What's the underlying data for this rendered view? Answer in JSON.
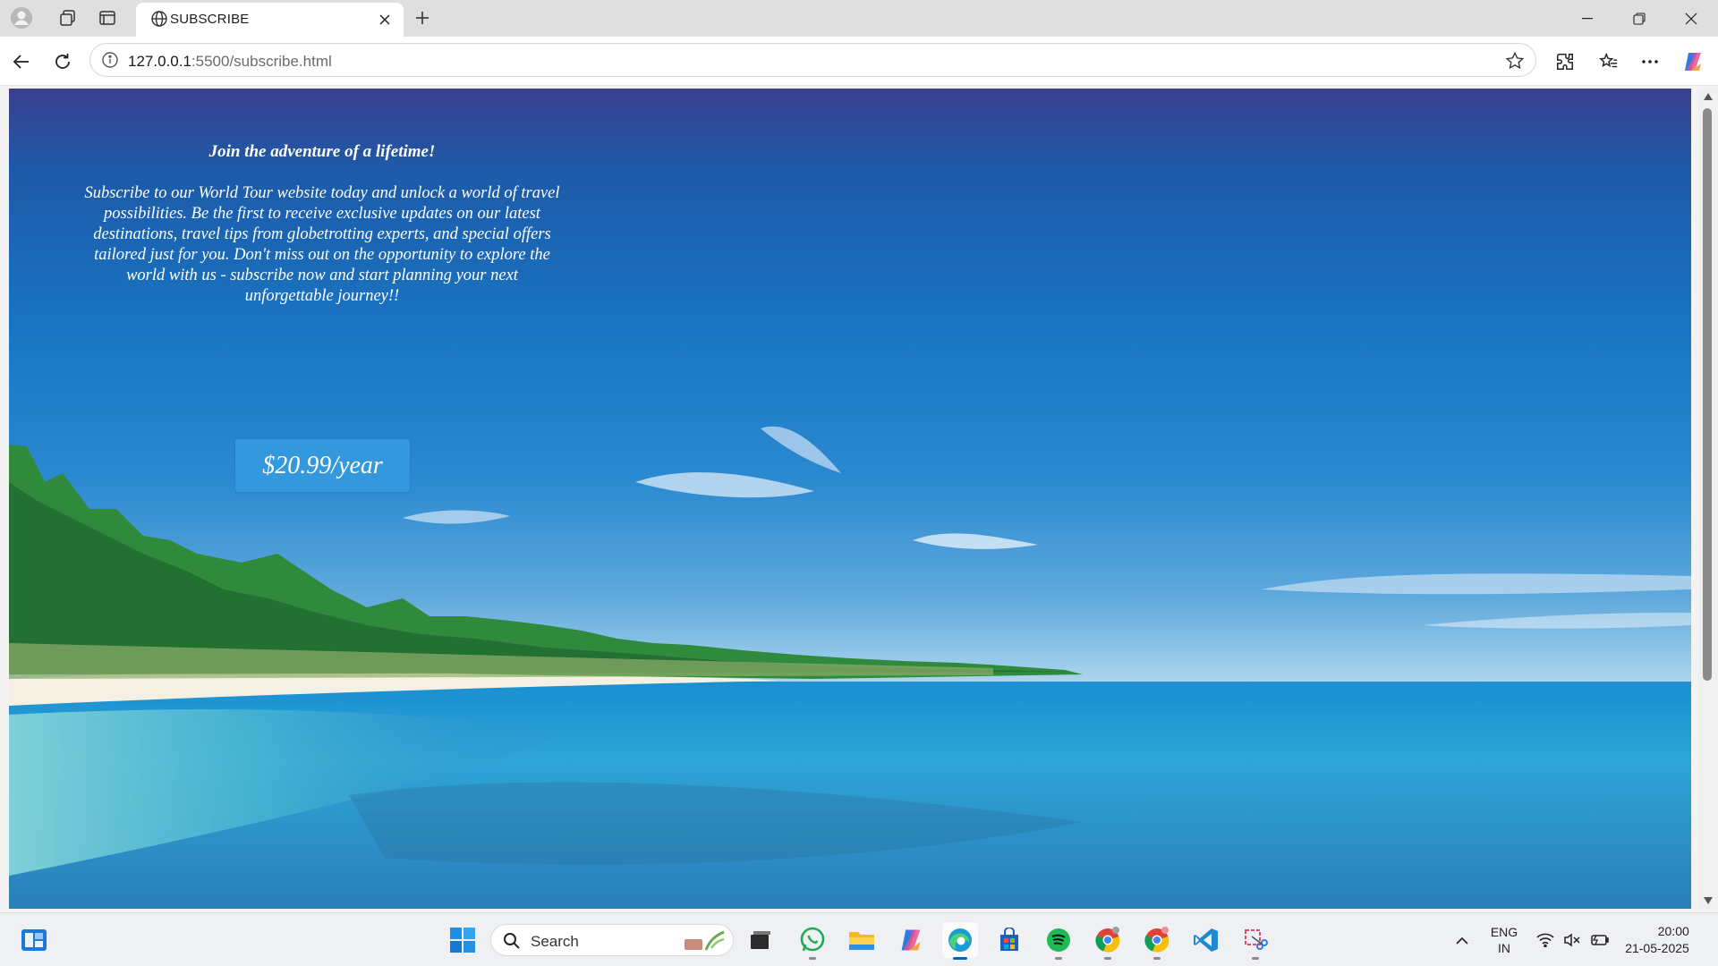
{
  "browser": {
    "tab_title": "SUBSCRIBE",
    "url_host": "127.0.0.1",
    "url_rest": ":5500/subscribe.html"
  },
  "page": {
    "heading": "Join the adventure of a lifetime!",
    "body": "Subscribe to our World Tour website today and unlock a world of travel possibilities. Be the first to receive exclusive updates on our latest destinations, travel tips from globetrotting experts, and special offers tailored just for you. Don't miss out on the opportunity to explore the world with us - subscribe now and start planning your next unforgettable journey!!",
    "price_button": "$20.99/year"
  },
  "taskbar": {
    "search_label": "Search",
    "lang_line1": "ENG",
    "lang_line2": "IN",
    "time": "20:00",
    "date": "21-05-2025"
  }
}
